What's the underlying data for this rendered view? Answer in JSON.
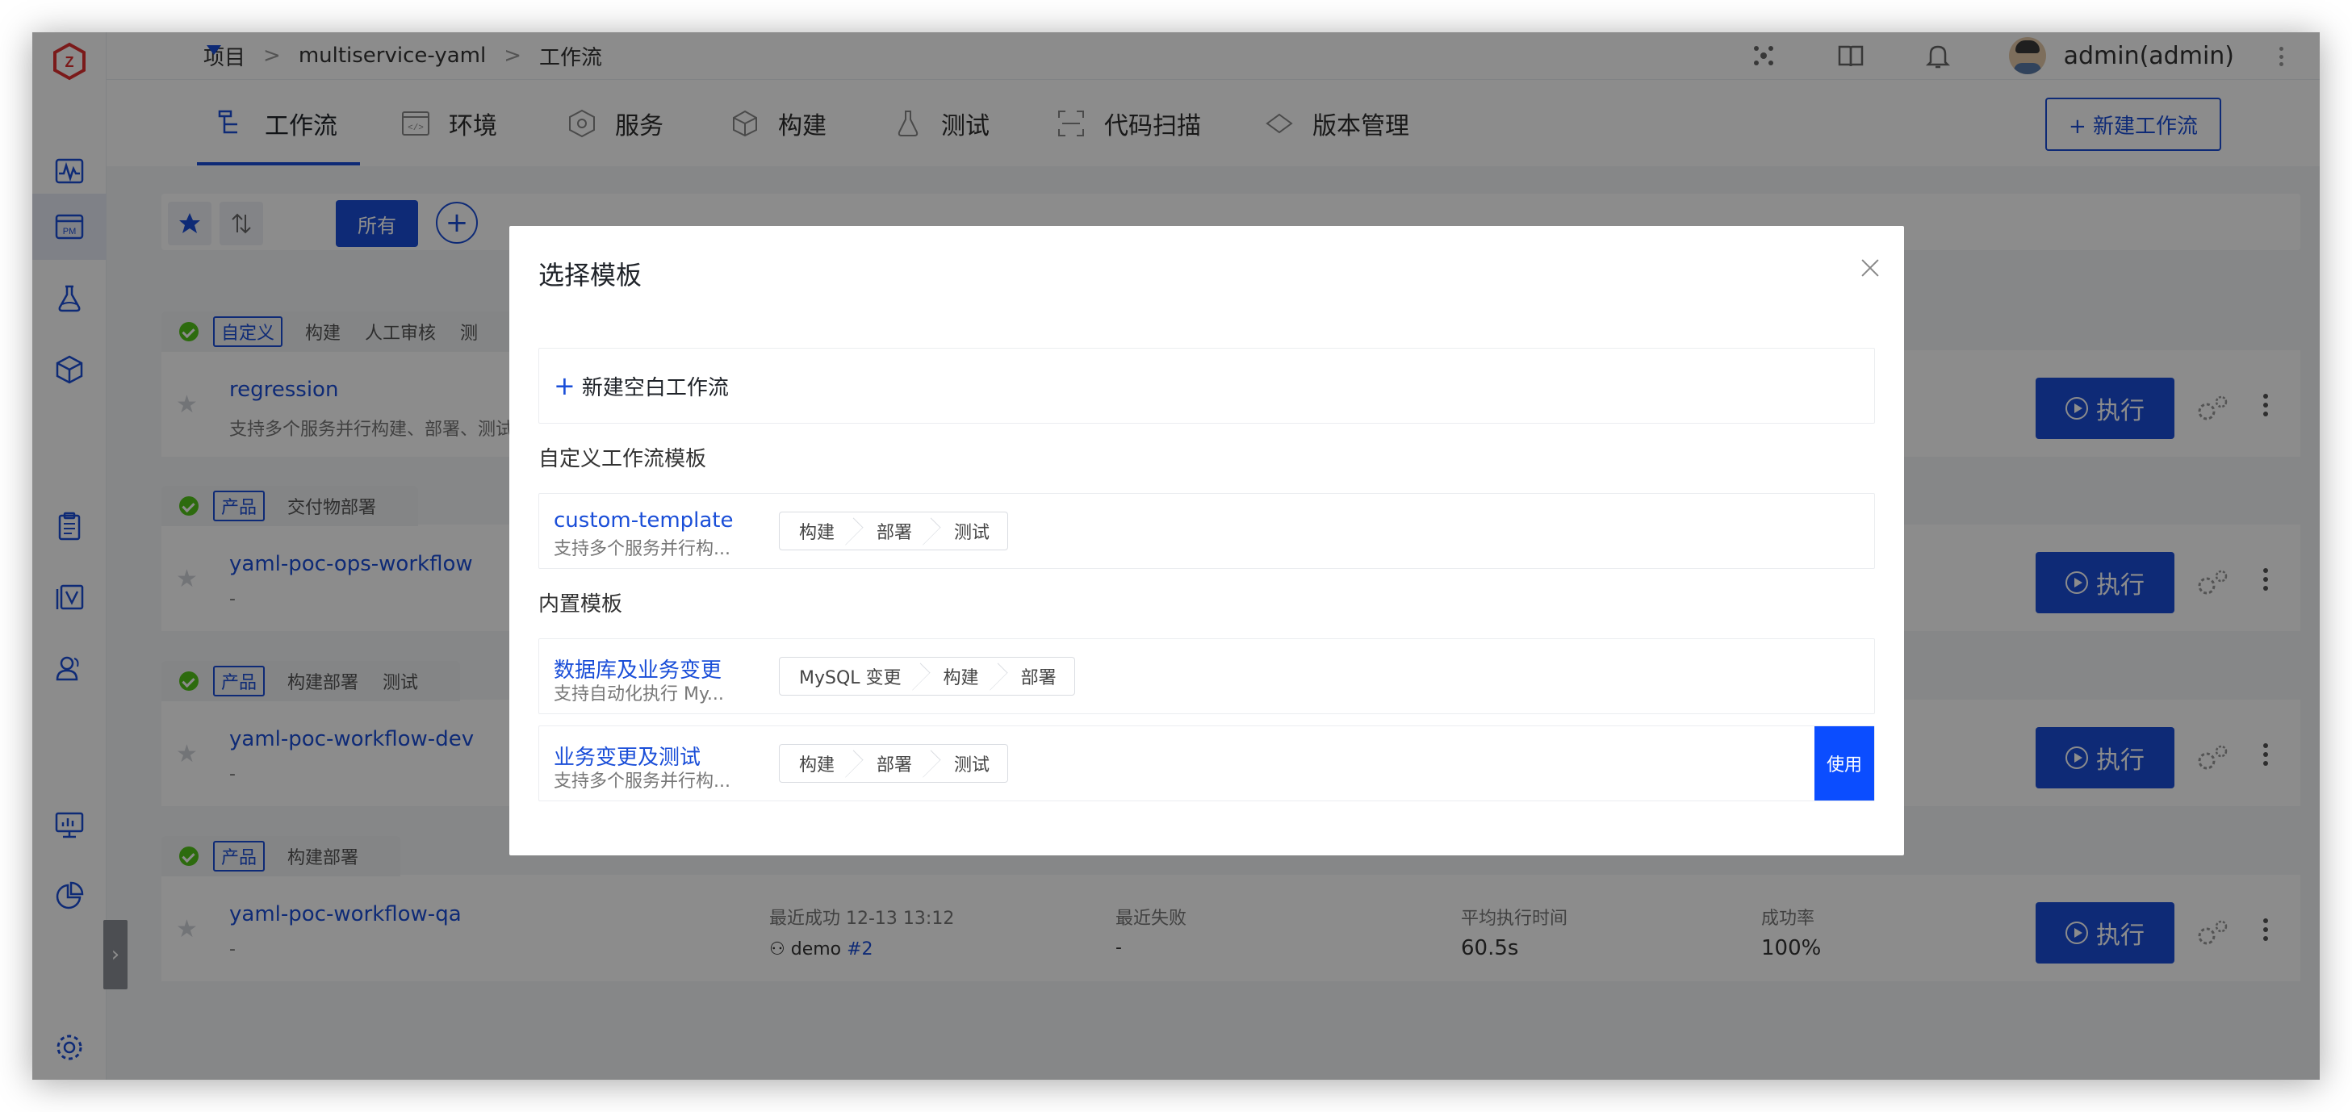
{
  "breadcrumb": {
    "root": "项目",
    "sep": ">",
    "project": "multiservice-yaml",
    "page": "工作流"
  },
  "user": {
    "name": "admin(admin)"
  },
  "tabs": [
    {
      "label": "工作流",
      "icon": "workflow-icon"
    },
    {
      "label": "环境",
      "icon": "environment-icon"
    },
    {
      "label": "服务",
      "icon": "service-icon"
    },
    {
      "label": "构建",
      "icon": "build-icon"
    },
    {
      "label": "测试",
      "icon": "test-icon"
    },
    {
      "label": "代码扫描",
      "icon": "code-scan-icon"
    },
    {
      "label": "版本管理",
      "icon": "version-icon"
    }
  ],
  "toolbar": {
    "new_workflow": "+ 新建工作流",
    "all_label": "所有",
    "add": "+"
  },
  "workflows": [
    {
      "type": "自定义",
      "stages": [
        "构建",
        "人工审核",
        "测"
      ],
      "name": "regression",
      "desc": "支持多个服务并行构建、部署、测试",
      "run": "执行"
    },
    {
      "type": "产品",
      "stages": [
        "交付物部署"
      ],
      "name": "yaml-poc-ops-workflow",
      "desc": "-",
      "run": "执行"
    },
    {
      "type": "产品",
      "stages": [
        "构建部署",
        "测试"
      ],
      "name": "yaml-poc-workflow-dev",
      "desc": "-",
      "run": "执行"
    },
    {
      "type": "产品",
      "stages": [
        "构建部署"
      ],
      "name": "yaml-poc-workflow-qa",
      "desc": "-",
      "run": "执行",
      "stats": {
        "last_success_label": "最近成功 12-13 13:12",
        "last_success_user": "demo",
        "last_success_run": "#2",
        "last_fail_label": "最近失败",
        "last_fail_value": "-",
        "avg_time_label": "平均执行时间",
        "avg_time_value": "60.5s",
        "success_rate_label": "成功率",
        "success_rate_value": "100%"
      }
    }
  ],
  "modal": {
    "title": "选择模板",
    "blank_label": "新建空白工作流",
    "custom_section": "自定义工作流模板",
    "builtin_section": "内置模板",
    "custom_templates": [
      {
        "name": "custom-template",
        "desc": "支持多个服务并行构...",
        "stages": [
          "构建",
          "部署",
          "测试"
        ]
      }
    ],
    "builtin_templates": [
      {
        "name": "数据库及业务变更",
        "desc": "支持自动化执行 My...",
        "stages": [
          "MySQL 变更",
          "构建",
          "部署"
        ]
      },
      {
        "name": "业务变更及测试",
        "desc": "支持多个服务并行构...",
        "stages": [
          "构建",
          "部署",
          "测试"
        ],
        "use_label": "使用"
      }
    ]
  },
  "colors": {
    "accent": "#1a4ed8",
    "use_button": "#0b4dff",
    "success": "#52c41a",
    "logo": "#e03030"
  }
}
